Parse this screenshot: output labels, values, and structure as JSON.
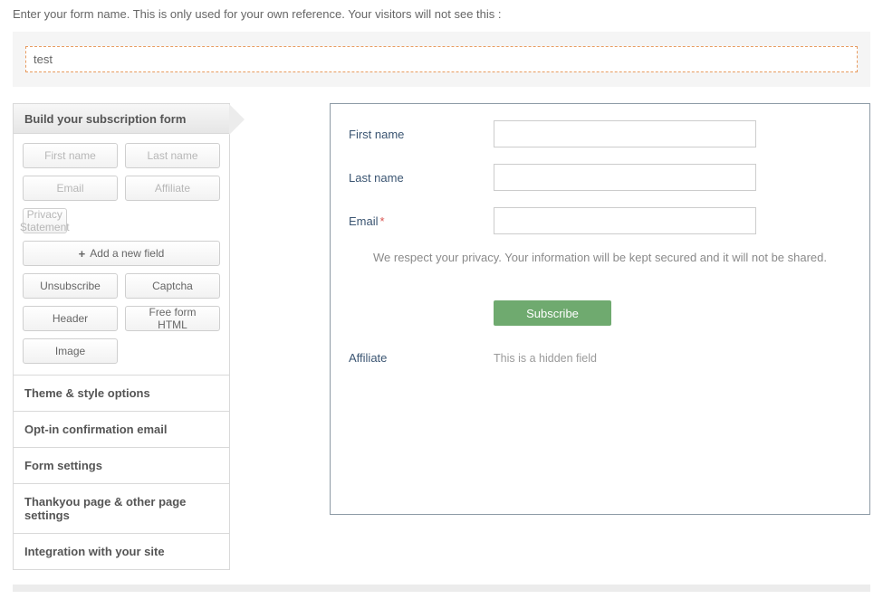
{
  "instruction": "Enter your form name. This is only used for your own reference. Your visitors will not see this :",
  "form_name": "test",
  "sidebar": {
    "title": "Build your subscription form",
    "used_fields": [
      {
        "label": "First name"
      },
      {
        "label": "Last name"
      },
      {
        "label": "Email"
      },
      {
        "label": "Affiliate"
      },
      {
        "label": "Privacy Statement"
      }
    ],
    "add_field": "Add a new field",
    "add_icon": "+",
    "other_fields": [
      {
        "label": "Unsubscribe"
      },
      {
        "label": "Captcha"
      },
      {
        "label": "Header"
      },
      {
        "label": "Free form HTML"
      },
      {
        "label": "Image"
      }
    ],
    "accordion": [
      "Theme & style options",
      "Opt-in confirmation email",
      "Form settings",
      "Thankyou page & other page settings",
      "Integration with your site"
    ]
  },
  "preview": {
    "fields": {
      "first_name": {
        "label": "First name",
        "value": ""
      },
      "last_name": {
        "label": "Last name",
        "value": ""
      },
      "email": {
        "label": "Email",
        "required_mark": "*",
        "value": ""
      }
    },
    "privacy_text": "We respect your privacy. Your information will be kept secured and it will not be shared.",
    "subscribe_label": "Subscribe",
    "affiliate": {
      "label": "Affiliate",
      "note": "This is a hidden field"
    }
  }
}
